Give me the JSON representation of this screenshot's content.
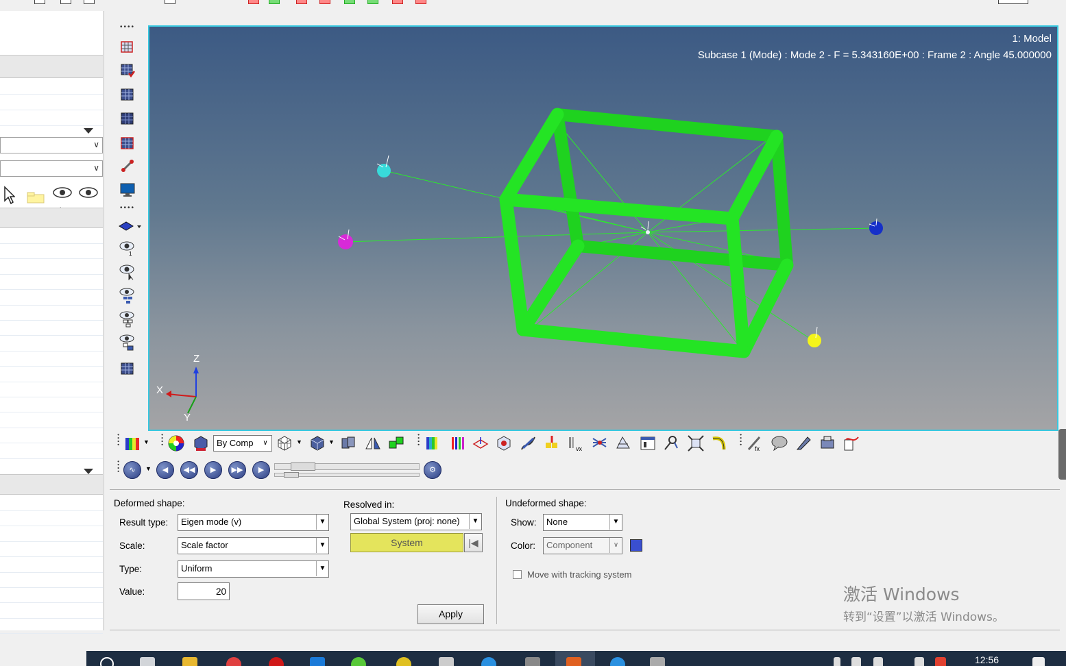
{
  "viewport": {
    "title": "1: Model",
    "subtitle": "Subcase 1 (Mode) : Mode 2 - F = 5.343160E+00 : Frame 2 : Angle 45.000000",
    "axis_x": "X",
    "axis_y": "Y",
    "axis_z": "Z",
    "background_top": "#3c5a84",
    "background_bottom": "#a4a4a6",
    "model_color": "#1fd21f"
  },
  "toolbar": {
    "color_mode": "By Comp"
  },
  "left_panel": {
    "icons": [
      "cursor-icon",
      "folder-icon",
      "eye-plus-minus-icon",
      "eye-1-icon"
    ],
    "eye_pm_label": "+/–",
    "eye_1_label": "1"
  },
  "deformed": {
    "section_label": "Deformed shape:",
    "result_type_label": "Result type:",
    "result_type_value": "Eigen mode (v)",
    "scale_label": "Scale:",
    "scale_value": "Scale factor",
    "type_label": "Type:",
    "type_value": "Uniform",
    "value_label": "Value:",
    "value_value": "20"
  },
  "resolved": {
    "label": "Resolved in:",
    "value": "Global System (proj: none)",
    "system_button": "System",
    "apply_button": "Apply"
  },
  "undeformed": {
    "section_label": "Undeformed shape:",
    "show_label": "Show:",
    "show_value": "None",
    "color_label": "Color:",
    "color_value": "Component",
    "color_swatch": "#3a4fd0",
    "move_tracking_label": "Move with tracking system"
  },
  "watermark": {
    "line1": "激活 Windows",
    "line2": "转到“设置”以激活 Windows。"
  },
  "taskbar": {
    "clock": "12:56"
  }
}
